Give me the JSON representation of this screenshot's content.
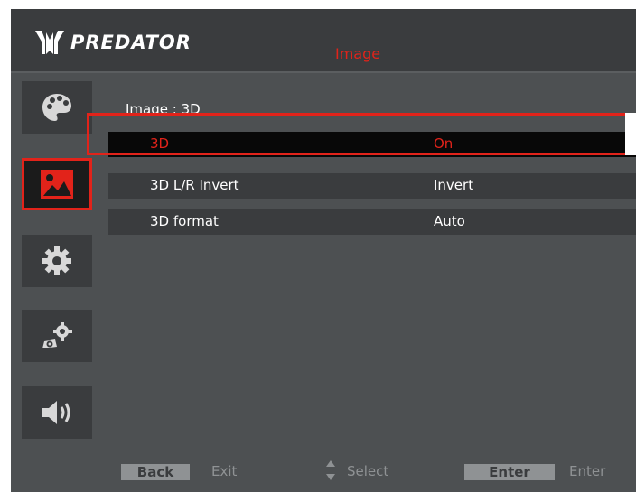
{
  "header": {
    "brand": "PREDATOR",
    "menu_title": "Image"
  },
  "sidebar": {
    "items": [
      {
        "name": "palette",
        "active": false
      },
      {
        "name": "image",
        "active": true
      },
      {
        "name": "settings",
        "active": false
      },
      {
        "name": "advanced-settings",
        "active": false
      },
      {
        "name": "audio",
        "active": false
      }
    ]
  },
  "main": {
    "subtitle": "Image : 3D",
    "rows": [
      {
        "label": "3D",
        "value": "On",
        "selected": true
      },
      {
        "label": "3D L/R Invert",
        "value": "Invert",
        "selected": false
      },
      {
        "label": "3D format",
        "value": "Auto",
        "selected": false
      }
    ]
  },
  "footer": {
    "back_key": "Back",
    "back_label": "Exit",
    "select_label": "Select",
    "enter_key": "Enter",
    "enter_label": "Enter"
  },
  "colors": {
    "accent": "#e2231a",
    "panel": "#4d5052",
    "bar": "#3a3c3e",
    "footer_key": "#8f9294"
  }
}
